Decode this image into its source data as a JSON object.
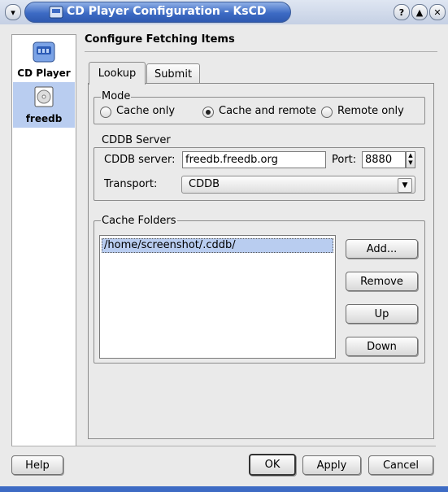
{
  "window": {
    "title": "CD Player Configuration - KsCD",
    "controls": {
      "help": "?",
      "shade": "▲",
      "close": "✕"
    }
  },
  "sidebar": {
    "items": [
      {
        "label": "CD Player",
        "icon": "cd-player-icon",
        "selected": false
      },
      {
        "label": "freedb",
        "icon": "freedb-icon",
        "selected": true
      }
    ]
  },
  "page": {
    "heading": "Configure Fetching Items",
    "tabs": [
      {
        "label": "Lookup",
        "active": true
      },
      {
        "label": "Submit",
        "active": false
      }
    ]
  },
  "mode": {
    "title": "Mode",
    "options": [
      {
        "label": "Cache only",
        "checked": false
      },
      {
        "label": "Cache and remote",
        "checked": true
      },
      {
        "label": "Remote only",
        "checked": false
      }
    ]
  },
  "cddb": {
    "title": "CDDB Server",
    "server_label": "CDDB server:",
    "server_value": "freedb.freedb.org",
    "port_label": "Port:",
    "port_value": "8880",
    "transport_label": "Transport:",
    "transport_value": "CDDB"
  },
  "cache": {
    "title": "Cache Folders",
    "folders": [
      "/home/screenshot/.cddb/"
    ],
    "buttons": {
      "add": "Add...",
      "remove": "Remove",
      "up": "Up",
      "down": "Down"
    }
  },
  "footer": {
    "help": "Help",
    "ok": "OK",
    "apply": "Apply",
    "cancel": "Cancel"
  },
  "colors": {
    "accent": "#3d6bc4",
    "selection": "#b9cdf0"
  }
}
